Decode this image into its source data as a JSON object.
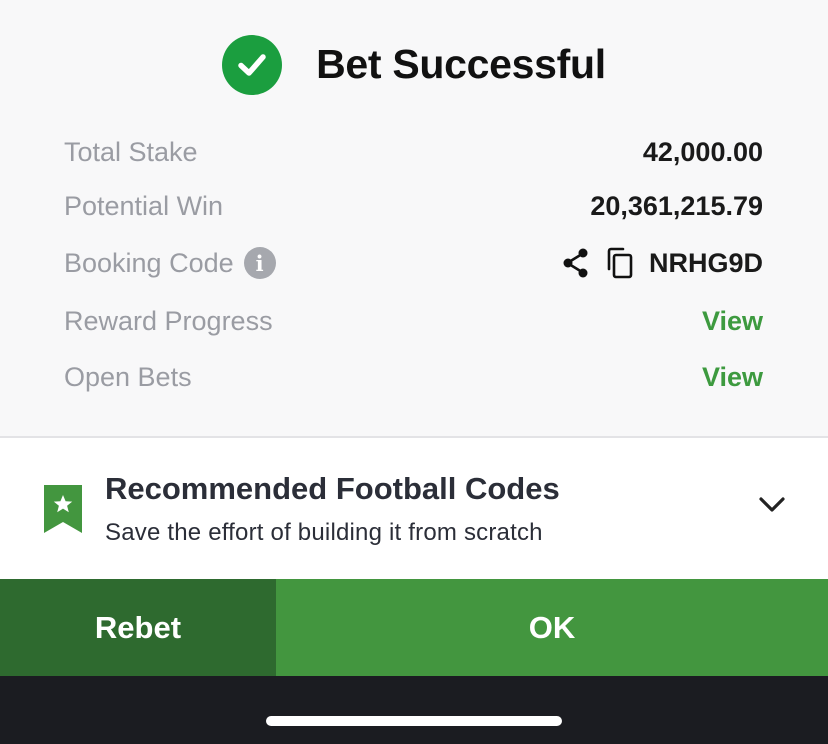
{
  "header": {
    "title": "Bet Successful",
    "icon": "check-circle-icon"
  },
  "summary": {
    "total_stake_label": "Total Stake",
    "total_stake_value": "42,000.00",
    "potential_win_label": "Potential Win",
    "potential_win_value": "20,361,215.79",
    "booking_code_label": "Booking Code",
    "booking_code_value": "NRHG9D",
    "reward_progress_label": "Reward Progress",
    "reward_progress_link": "View",
    "open_bets_label": "Open Bets",
    "open_bets_link": "View"
  },
  "recommended": {
    "title": "Recommended Football Codes",
    "subtitle": "Save the effort of building it from scratch"
  },
  "buttons": {
    "rebet": "Rebet",
    "ok": "OK"
  },
  "colors": {
    "success_green": "#1b9e3f",
    "link_green": "#3d9a3f",
    "rebet_bg": "#2e6a2f",
    "ok_bg": "#43963f",
    "label_gray": "#9a9ca3"
  }
}
